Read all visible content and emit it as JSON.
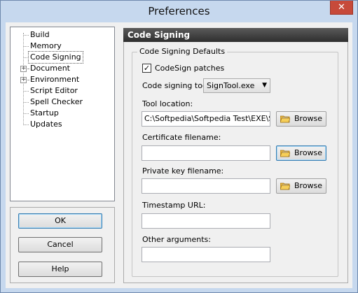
{
  "window": {
    "title": "Preferences",
    "close_glyph": "✕"
  },
  "tree": {
    "items": [
      {
        "label": "Build",
        "expandable": false
      },
      {
        "label": "Memory",
        "expandable": false
      },
      {
        "label": "Code Signing",
        "expandable": false,
        "selected": true
      },
      {
        "label": "Document",
        "expandable": true
      },
      {
        "label": "Environment",
        "expandable": true
      },
      {
        "label": "Script Editor",
        "expandable": false
      },
      {
        "label": "Spell Checker",
        "expandable": false
      },
      {
        "label": "Startup",
        "expandable": false
      },
      {
        "label": "Updates",
        "expandable": false
      }
    ]
  },
  "buttons": {
    "ok": "OK",
    "cancel": "Cancel",
    "help": "Help"
  },
  "page": {
    "header": "Code Signing",
    "group_title": "Code Signing Defaults",
    "codesign_patches": {
      "label": "CodeSign patches",
      "checked": true
    },
    "signing_tool": {
      "label": "Code signing tool:",
      "value": "SignTool.exe"
    },
    "tool_location": {
      "label": "Tool location:",
      "value": "C:\\Softpedia\\Softpedia Test\\EXE\\Sc"
    },
    "certificate": {
      "label": "Certificate filename:",
      "value": ""
    },
    "private_key": {
      "label": "Private key filename:",
      "value": ""
    },
    "timestamp": {
      "label": "Timestamp URL:",
      "value": ""
    },
    "other_args": {
      "label": "Other arguments:",
      "value": ""
    },
    "browse_label": "Browse"
  }
}
